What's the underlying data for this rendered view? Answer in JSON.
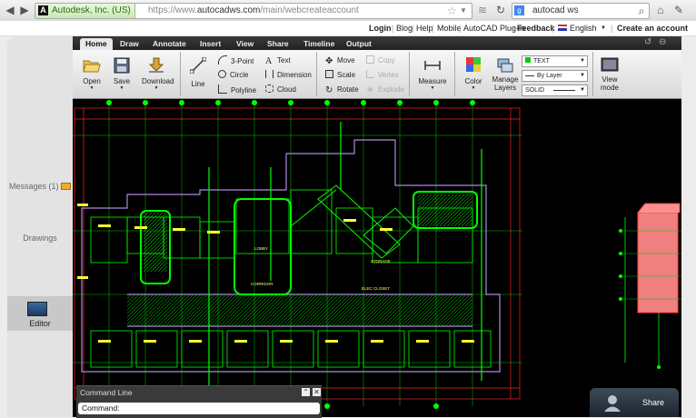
{
  "browser": {
    "site_identity": "Autodesk, Inc. (US)",
    "url_prefix": "https://www.",
    "url_host": "autocadws.com",
    "url_path": "/main/webcreateaccount",
    "search_text": "autocad ws"
  },
  "site_nav": {
    "login": "Login",
    "blog": "Blog",
    "help": "Help",
    "mobile": "Mobile",
    "plugin": "AutoCAD Plug-in",
    "feedback": "Feedback",
    "language": "English",
    "create_account": "Create an account"
  },
  "left_panel": {
    "messages": "Messages (1)",
    "drawings": "Drawings",
    "editor": "Editor"
  },
  "tabs": [
    "Home",
    "Draw",
    "Annotate",
    "Insert",
    "View",
    "Share",
    "Timeline",
    "Output"
  ],
  "ribbon": {
    "open": "Open",
    "save": "Save",
    "download": "Download",
    "line": "Line",
    "three_point": "3-Point",
    "circle": "Circle",
    "polyline": "Polyline",
    "text": "Text",
    "dimension": "Dimension",
    "cloud": "Cloud",
    "move": "Move",
    "scale": "Scale",
    "rotate": "Rotate",
    "copy": "Copy",
    "vertex": "Vertex",
    "explode": "Explode",
    "measure": "Measure",
    "color": "Color",
    "manage_layers": "Manage Layers",
    "layer_value": "TEXT",
    "linetype_value": "By Layer",
    "lineweight_value": "SOLID",
    "view_mode": "View mode"
  },
  "command_line": {
    "title": "Command Line",
    "prompt": "Command:"
  },
  "share": {
    "label": "Share"
  },
  "colors": {
    "canvas": "#000000",
    "cad_green": "#00ff00",
    "cad_red": "#ff2020",
    "cad_yellow": "#ffff33",
    "cad_purple": "#b088e0"
  },
  "drawing_labels": [
    "LOBBY",
    "CORRIDOR",
    "STORAGE",
    "ELEC CLOSET"
  ]
}
